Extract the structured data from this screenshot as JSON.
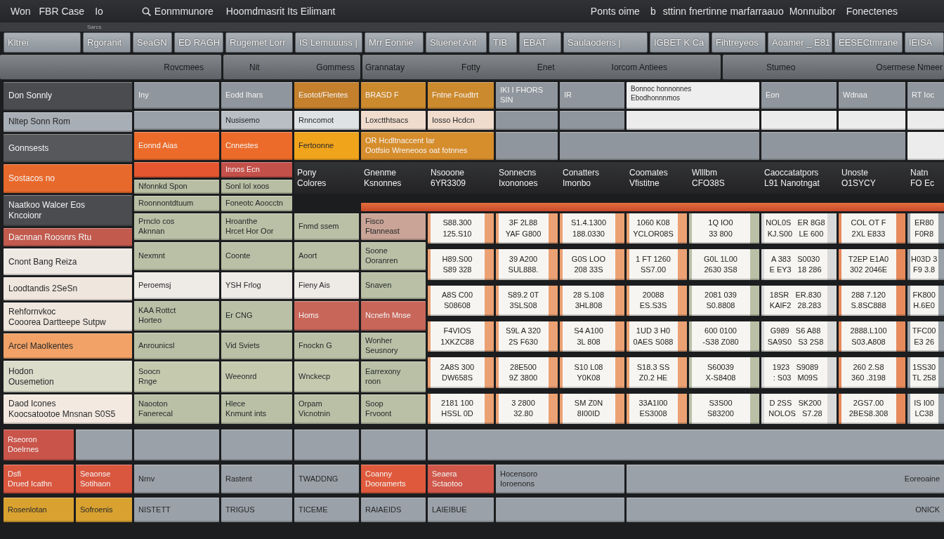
{
  "title_bar": {
    "left": [
      {
        "kind": "label",
        "text": "Won"
      },
      {
        "kind": "label",
        "text": "FBR Case"
      },
      {
        "kind": "label",
        "text": "Io"
      },
      {
        "kind": "search",
        "text": "Eonmmunore"
      },
      {
        "kind": "label",
        "text": "Hoomdmasrit Its Eilimant"
      }
    ],
    "right": [
      {
        "kind": "label",
        "text": "Ponts oime"
      },
      {
        "kind": "label",
        "text": "b"
      },
      {
        "kind": "label",
        "text": "sttinn fnertinne marfarraauo"
      },
      {
        "kind": "label",
        "text": "Monnuibor"
      },
      {
        "kind": "label",
        "text": "Fonectenes"
      }
    ]
  },
  "caption": "Sarcs",
  "toolbar": {
    "buttons": [
      "Kltrei",
      "Rgoranit",
      "SeaGN",
      "ED RAGH",
      "Rugemet Lorr",
      "IS Lemuuuss |",
      "Mrr Eonnie",
      "Sluenet Arit",
      "TIB",
      "EBAT",
      "Saulaoderis |",
      "IGBET K Ca",
      "Fihtreyeos",
      "Aoamer _ E81",
      "EESECtmrane",
      "IEISA"
    ]
  },
  "header_groups": [
    {
      "labels": [
        "Rovcmees"
      ]
    },
    {
      "labels": [
        "Nit",
        "Gommess"
      ]
    },
    {
      "labels": [
        "Grannatay",
        "Fotty",
        "Enet",
        "Iorcom Antiees"
      ]
    },
    {
      "labels": [
        "Stumeo",
        "Osermese Nmeer"
      ]
    }
  ],
  "sheet": {
    "column_1": [
      {
        "text": "Don Sonnly",
        "color": "#4a4c4f"
      },
      {
        "text": "Nltep Sonn Rom",
        "color": "#a8aeb5"
      },
      {
        "text": "Gonnsests",
        "color": "#56585b"
      },
      {
        "text": "Sostacos no",
        "color": "#e8692c"
      },
      {
        "text": "Naatkoo Walcer Eos\nKncoionr",
        "color": "#4a4c4f"
      },
      {
        "text": "Dacnnan Roosnrs Rtu",
        "color": "#c25a4e"
      },
      {
        "text": "Cnont Bang Reiza",
        "color": "#efe9e4"
      },
      {
        "text": "Loodtandis 2SeSn",
        "color": "#efe6dd"
      },
      {
        "text": "Rehfornvkoc\nCooorea Dartteepe Sutpw",
        "color": "#efe6dd"
      },
      {
        "text": "Arcel Maolkentes",
        "color": "#f2a266"
      },
      {
        "text": "Hodon\nOusemetion",
        "color": "#dcdccb"
      },
      {
        "text": "Daod Icones\nKoocsatootoe Mnsnan S0S5",
        "color": "#f3e9e0"
      }
    ],
    "column_2": [
      {
        "text": "Iny",
        "color": "#8f969d"
      },
      {
        "color": "#9aa1a8"
      },
      {
        "text": "Eonnd Aias",
        "color": "#ec6b2a"
      },
      {
        "color": "#e3562f"
      },
      {
        "text": "Nfonnkd Spon",
        "color": "#b7bea3"
      },
      {
        "text": "Roonnontdtuum",
        "color": "#b7bea3"
      },
      {
        "text": "Prnclo cos\nAknnan",
        "color": "#b9c0a6"
      },
      {
        "text": "Nexmnt",
        "color": "#b9c0a6"
      },
      {
        "text": "Peroemsj",
        "color": "#eeeae6"
      },
      {
        "text": "KAA Rottct\nHorteo",
        "color": "#b9c0a6"
      },
      {
        "text": "Anrounicsl",
        "color": "#b9c0a6"
      },
      {
        "text": "Soocn\nRnge",
        "color": "#c5caaf"
      },
      {
        "text": "Naooton\nFanerecal",
        "color": "#b9c0a6"
      }
    ],
    "column_3": [
      {
        "text": "Eodd Ihars",
        "color": "#8f969d"
      },
      {
        "text": "Nusisemo",
        "color": "#b8bec4"
      },
      {
        "text": "Cnnestes",
        "color": "#ec6b2a"
      },
      {
        "text": "Innos Ecn",
        "color": "#c4504a"
      },
      {
        "text": "Sonl lol xoos",
        "color": "#b7bea3"
      },
      {
        "text": "Foneotc Aoocctn",
        "color": "#b7bea3"
      },
      {
        "text": "Hroanthe\nHrcet Hor Oor",
        "color": "#b9c0a6"
      },
      {
        "text": "Coonte",
        "color": "#b9c0a6"
      },
      {
        "text": "YSH Frlog",
        "color": "#eeeae6"
      },
      {
        "text": "Er CNG",
        "color": "#b9c0a6"
      },
      {
        "text": "Vid Sviets",
        "color": "#b9c0a6"
      },
      {
        "text": "Weeonrd",
        "color": "#c5caaf"
      },
      {
        "text": "Hlece\nKnmunt ints",
        "color": "#b9c0a6"
      }
    ],
    "column_4": [
      {
        "text": "Esotot/Flentes",
        "color": "#c4802c"
      },
      {
        "text": "Rnncomot",
        "color": "#dfe2e4"
      },
      {
        "text": "Fertoonne",
        "color": "#f0a41c"
      },
      {
        "text": "Fnmd ssem",
        "color": "#b9c0a6"
      },
      {
        "text": "Aoort",
        "color": "#b9c0a6"
      },
      {
        "text": "Fieny Ais",
        "color": "#eeeae6"
      },
      {
        "text": "Homs",
        "color": "#c8665a"
      },
      {
        "text": "Fnockn G",
        "color": "#b9c0a6"
      },
      {
        "text": "Wnckecp",
        "color": "#c5caaf"
      },
      {
        "text": "Orpam\nVicnotnin",
        "color": "#b9c0a6"
      }
    ],
    "column_5": [
      {
        "text": "BRASD F",
        "color": "#cc8a2e"
      },
      {
        "text": "Loxctthtsacs",
        "color": "#f0dccd"
      },
      {
        "text": "OR Hcdltnaccent Iar\nOotfsio Wreneoos oat fotnnes",
        "color": "#d68d2c"
      },
      {
        "text": "Fisco\nFtanneast",
        "color": "#c9a497"
      },
      {
        "text": "Soone\nOoranren",
        "color": "#b9c0a6"
      },
      {
        "text": "Snaven",
        "color": "#b9c0a6"
      },
      {
        "text": "Ncnefn Mnse",
        "color": "#c8665a"
      },
      {
        "text": "Wonher\nSeusnory",
        "color": "#b9c0a6"
      },
      {
        "text": "Earrexony\nroon",
        "color": "#b9c0a6"
      },
      {
        "text": "Soop\nFrvoont",
        "color": "#b9c0a6"
      }
    ],
    "right_block": [
      {
        "text": "Fntne Foudtrt",
        "color": "#cc8a2e"
      },
      {
        "text": "IKI I FHORS SIN",
        "color": "#8f969d"
      },
      {
        "text": "IR",
        "color": "#8f969d"
      },
      {
        "text": "Bonnoc honnonnes\nEbodhonnnmos",
        "color": "#eeeeee"
      },
      {
        "text": "Eon",
        "color": "#8f969d"
      },
      {
        "text": "Wdnaa",
        "color": "#8f969d"
      },
      {
        "text": "RT Ioc",
        "color": "#8f969d"
      },
      {
        "text": "Iosso Hcdcn",
        "color": "#f0dccd"
      },
      {
        "color": "#8f969d"
      },
      {
        "color": "#8f969d"
      },
      {
        "color": "#ececec"
      },
      {
        "color": "#ececec"
      },
      {
        "color": "#ececec"
      },
      {
        "color": "#ececec"
      },
      {
        "color": "#8f969d"
      },
      {
        "color": "#8f969d"
      },
      {
        "color": "#8f969d"
      },
      {
        "color": "#ececec"
      }
    ],
    "header_band": {
      "labels": [
        "Pony\nColores",
        "Gnenme\nKsnonnes",
        "Nsooone\n6YR3309",
        "Sonnecns\nIxononoes",
        "Conatters\nImonbo",
        "Coomates\nVfistitne",
        "Wlllbm\nCFO38S",
        "Caoccatatpors\nL91 Nanotngat",
        "Unoste\nO1SYCY",
        "Natn\nFO Ec"
      ]
    },
    "value_table": {
      "columns": [
        {
          "color": "#eba173"
        },
        {
          "color": "#eba173"
        },
        {
          "color": "#eba173"
        },
        {
          "color": "#eba173"
        },
        {
          "color": "#b9c0a6"
        },
        {
          "color": "#d9d9d9"
        },
        {
          "color": "#e68a5c"
        },
        {
          "color": "#9aa1a8"
        }
      ],
      "rows": [
        {
          "cells": [
            "S88.300\n125.S10",
            "3F 2L88\nYAF G800",
            "S1.4.1300\n188.0330",
            "1060 K08\nYCLOR08S",
            "1Q IO0\n33 800",
            "NOL0S   ER 8G8\nKJ.S00   LE 600",
            "COL OT F\n2XL E833",
            "ER80\nF0R8"
          ]
        },
        {
          "cells": [
            "H89.S00\nS89 328",
            "39 A200\nSUL888.",
            "G0S LOO\n208 33S",
            "1 FT 1260\nSS7.00",
            "G0L 1L00\n2630 3S8",
            "A 383   S0030\nE EY3   18 286",
            "T2EP E1A0\n302 2046E",
            "H03D 3\nF9 3.8"
          ]
        },
        {
          "cells": [
            "A8S C00\nS08608",
            "S89.2 0T\n3SLS08",
            "28 S.108\n3HL808",
            "20088\nES.S3S",
            "2081 039\nS0.8808",
            "18SR   ER.830\nKAIF2   28.283",
            "288 7.120\nS.8SC888",
            "FK800\nH.6E0"
          ]
        },
        {
          "cells": [
            "F4VIOS\n1XKZC88",
            "S9L A 320\n2S F630",
            "S4 A100\n3L 808",
            "1UD 3 H0\n0AES S088",
            "600 0100\n-S38 Z080",
            "G989   S6 A88\nSA9S0   S3 2S8",
            "2888.L100\nS03.A808",
            "TFC00\nE3 26"
          ]
        },
        {
          "cells": [
            "2A8S 300\nDW658S",
            "28E500\n9Z 3800",
            "S10 L08\nY0K08",
            "S18.3 SS\nZ0.2 HE",
            "S60039\nX-S8408",
            "1923   S9089\n: S03   M09S",
            "260 2.S8\n360 .3198",
            "1SS30\nTL 258"
          ]
        },
        {
          "cells": [
            "2181 100\nHSSL 0D",
            "3 2800\n32.80",
            "SM Z0N\n8I00ID",
            "33A1I00\nES3008",
            "S3S00\nS83200",
            "D 2SS   SK200\nNOLOS   S7.28",
            "2GS7.00\n2BES8.308",
            "IS I00\nLC38"
          ]
        }
      ]
    }
  },
  "footer": {
    "rows": [
      {
        "cells": [
          {
            "text": "Rseoron\nDoelrnes",
            "color": "#c8544a"
          },
          {
            "color": "#9aa1a8"
          },
          {
            "color": "#9aa1a8"
          },
          {
            "color": "#9aa1a8"
          },
          {
            "color": "#9aa1a8"
          },
          {
            "color": "#9aa1a8"
          },
          {
            "color": "#9aa1a8"
          }
        ]
      },
      {
        "cells": [
          {
            "text": "Dsfi\nDrued Icathn",
            "color": "#d9563f"
          },
          {
            "text": "Seaonse\nSotihaon",
            "color": "#d9563f"
          },
          {
            "text": "Nrnv",
            "color": "#9aa1a8"
          },
          {
            "text": "Rastent",
            "color": "#9aa1a8"
          },
          {
            "text": "TWADDNG",
            "color": "#9aa1a8"
          },
          {
            "text": "Coanny\nDooramerts",
            "color": "#df5a3c"
          },
          {
            "text": "Seaera\nSctaotoo",
            "color": "#d0574a"
          },
          {
            "text": "Hocensoro\nIoroenons",
            "color": "#9aa1a8"
          },
          {
            "text": "Eoreoaine",
            "color": "#9aa1a8"
          }
        ]
      },
      {
        "cells": [
          {
            "text": "Rosenlotan",
            "color": "#d9a230"
          },
          {
            "text": "Sofroenis",
            "color": "#d9a230"
          },
          {
            "text": "NISTETT",
            "color": "#9aa1a8"
          },
          {
            "text": "TRIGUS",
            "color": "#9aa1a8"
          },
          {
            "text": "TICEME",
            "color": "#9aa1a8"
          },
          {
            "text": "RAIAEIDS",
            "color": "#9aa1a8"
          },
          {
            "text": "LAIEIBUE",
            "color": "#9aa1a8"
          },
          {
            "color": "#9aa1a8"
          },
          {
            "text": "ONICK",
            "color": "#9aa1a8"
          }
        ]
      }
    ]
  }
}
